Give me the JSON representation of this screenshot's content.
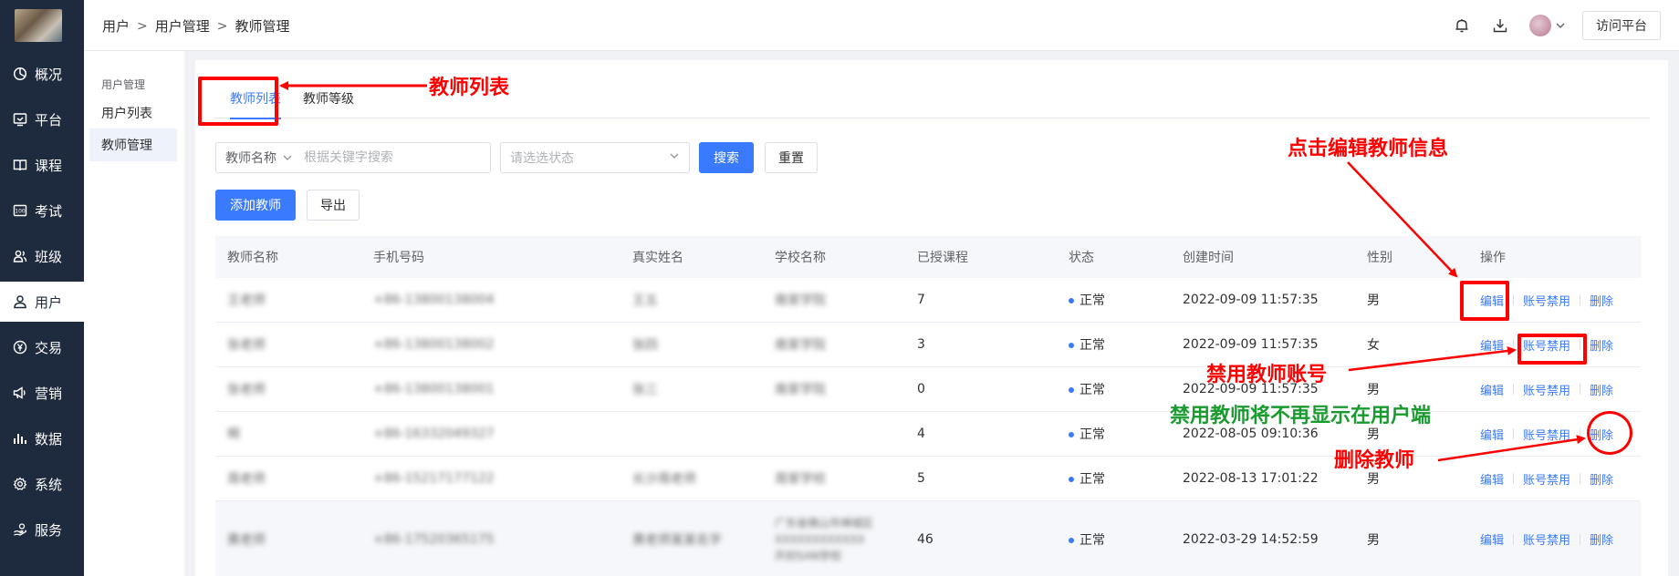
{
  "header": {
    "breadcrumb": [
      "用户",
      "用户管理",
      "教师管理"
    ],
    "visit_button": "访问平台",
    "icons": [
      "bell-icon",
      "download-icon",
      "avatar",
      "chevron-down-icon"
    ]
  },
  "sidebar": {
    "items": [
      {
        "label": "概况",
        "icon": "pie-chart-icon"
      },
      {
        "label": "平台",
        "icon": "monitor-icon"
      },
      {
        "label": "课程",
        "icon": "book-icon"
      },
      {
        "label": "考试",
        "icon": "exam-icon"
      },
      {
        "label": "班级",
        "icon": "group-icon"
      },
      {
        "label": "用户",
        "icon": "user-icon",
        "active": true
      },
      {
        "label": "交易",
        "icon": "yen-icon"
      },
      {
        "label": "营销",
        "icon": "megaphone-icon"
      },
      {
        "label": "数据",
        "icon": "bar-chart-icon"
      },
      {
        "label": "系统",
        "icon": "gear-icon"
      },
      {
        "label": "服务",
        "icon": "service-icon"
      }
    ]
  },
  "subnav": {
    "group_label": "用户管理",
    "items": [
      {
        "label": "用户列表"
      },
      {
        "label": "教师管理",
        "active": true
      }
    ]
  },
  "tabs": {
    "list": "教师列表",
    "level": "教师等级"
  },
  "filter": {
    "name_select": "教师名称",
    "keyword_placeholder": "根据关键字搜索",
    "status_placeholder": "请选选状态",
    "search_button": "搜索",
    "reset_button": "重置"
  },
  "actions": {
    "add_button": "添加教师",
    "export_button": "导出"
  },
  "table": {
    "headers": [
      "教师名称",
      "手机号码",
      "真实姓名",
      "学校名称",
      "已授课程",
      "状态",
      "创建时间",
      "性别",
      "操作"
    ],
    "op_labels": {
      "edit": "编辑",
      "disable": "账号禁用",
      "delete": "删除"
    },
    "rows": [
      {
        "name": "王老师",
        "phone": "+86-13800138004",
        "real_name": "王五",
        "school": "南家学院",
        "courses": "7",
        "status": "正常",
        "created": "2022-09-09 11:57:35",
        "gender": "男"
      },
      {
        "name": "张老师",
        "phone": "+86-13800138002",
        "real_name": "张四",
        "school": "南家学院",
        "courses": "3",
        "status": "正常",
        "created": "2022-09-09 11:57:35",
        "gender": "女"
      },
      {
        "name": "张老师",
        "phone": "+86-13800138001",
        "real_name": "张三",
        "school": "南家学院",
        "courses": "0",
        "status": "正常",
        "created": "2022-09-09 11:57:35",
        "gender": "男"
      },
      {
        "name": "啊",
        "phone": "+86-16332049327",
        "real_name": "",
        "school": "",
        "courses": "4",
        "status": "正常",
        "created": "2022-08-05 09:10:36",
        "gender": "男"
      },
      {
        "name": "周老师",
        "phone": "+86-15217177122",
        "real_name": "长沙周老师",
        "school": "周家学校",
        "courses": "5",
        "status": "正常",
        "created": "2022-08-13 17:01:22",
        "gender": "男"
      },
      {
        "name": "黄老师",
        "phone": "+86-17520365175",
        "real_name": "黄老师某某名字",
        "school_lines": [
          "广东省佛山市禅城区",
          "XXXXXXXXXXXX",
          "开封SAN学校"
        ],
        "courses": "46",
        "status": "正常",
        "created": "2022-03-29 14:52:59",
        "gender": "男"
      }
    ]
  },
  "annotations": {
    "tab_note": "教师列表",
    "edit_note": "点击编辑教师信息",
    "disable_note": "禁用教师账号",
    "disable_effect_note": "禁用教师将不再显示在用户端",
    "delete_note": "删除教师",
    "colors": {
      "red": "#ff0000",
      "green": "#1a9b2f"
    }
  }
}
